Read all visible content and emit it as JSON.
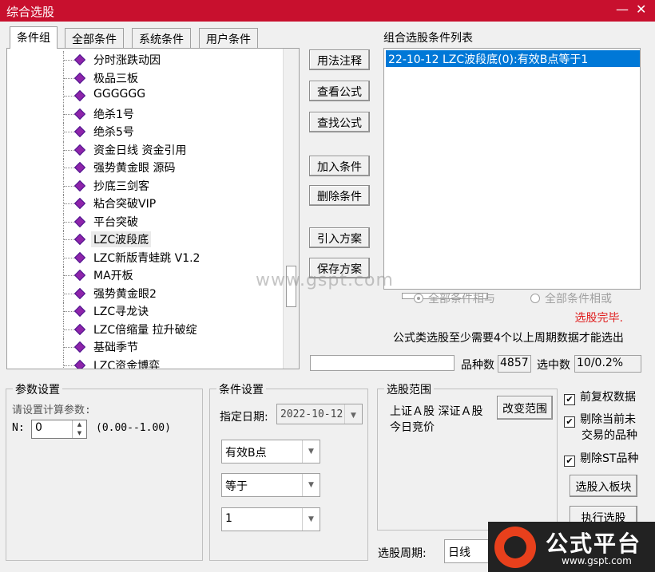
{
  "window": {
    "title": "综合选股",
    "min_glyph": "—",
    "close_glyph": "✕"
  },
  "tabs": [
    "条件组",
    "全部条件",
    "系统条件",
    "用户条件"
  ],
  "tree": {
    "items": [
      "分时涨跌动因",
      "极品三板",
      "GGGGGG",
      "绝杀1号",
      "绝杀5号",
      "资金日线 资金引用",
      "强势黄金眼 源码",
      "抄底三剑客",
      "粘合突破VIP",
      "平台突破",
      "LZC波段底",
      "LZC新版青蛙跳 V1.2",
      "MA开板",
      "强势黄金眼2",
      "LZC寻龙诀",
      "LZC倍缩量 拉升破绽",
      "基础季节",
      "LZC资金博弈"
    ],
    "selected_index": 10,
    "node_icon": "purple-diamond-icon"
  },
  "buttons": {
    "usage": "用法注释",
    "view_formula": "查看公式",
    "find_formula": "查找公式",
    "add_cond": "加入条件",
    "del_cond": "删除条件",
    "import_plan": "引入方案",
    "save_plan": "保存方案",
    "change_range": "改变范围",
    "to_sector": "选股入板块",
    "execute": "执行选股"
  },
  "cond_list": {
    "label": "组合选股条件列表",
    "items": [
      "22-10-12 LZC波段底(0):有效B点等于1"
    ]
  },
  "radios": {
    "and_label": "全部条件相与",
    "or_label": "全部条件相或",
    "selected": "and"
  },
  "status": {
    "done": "选股完毕.",
    "note": "公式类选股至少需要4个以上周期数据才能选出"
  },
  "counts": {
    "total_label": "品种数",
    "total_value": "4857",
    "hit_label": "选中数",
    "hit_value": "10/0.2%"
  },
  "params": {
    "title": "参数设置",
    "prompt": "请设置计算参数:",
    "n_label": "N:",
    "n_value": "0",
    "range": "(0.00--1.00)"
  },
  "cond_settings": {
    "title": "条件设置",
    "date_label": "指定日期:",
    "date_value": "2022-10-12",
    "combo1": "有效B点",
    "combo2": "等于",
    "combo3": "1"
  },
  "range": {
    "title": "选股范围",
    "line1": "上证Ａ股 深证Ａ股",
    "line2": "今日竞价"
  },
  "options": {
    "fq": "前复权数据",
    "exclude_untraded": "剔除当前未交易的品种",
    "exclude_untraded_l1": "剔除当前未",
    "exclude_untraded_l2": "交易的品种",
    "exclude_st": "剔除ST品种"
  },
  "period": {
    "label": "选股周期:",
    "value": "日线"
  },
  "watermark": "www.gspt.com",
  "logo": {
    "main": "公式平台",
    "sub": "www.gspt.com",
    "accent": "#e8401c"
  },
  "colors": {
    "titlebar": "#c8102e",
    "selection": "#0078d7",
    "status_red": "#e02020"
  }
}
